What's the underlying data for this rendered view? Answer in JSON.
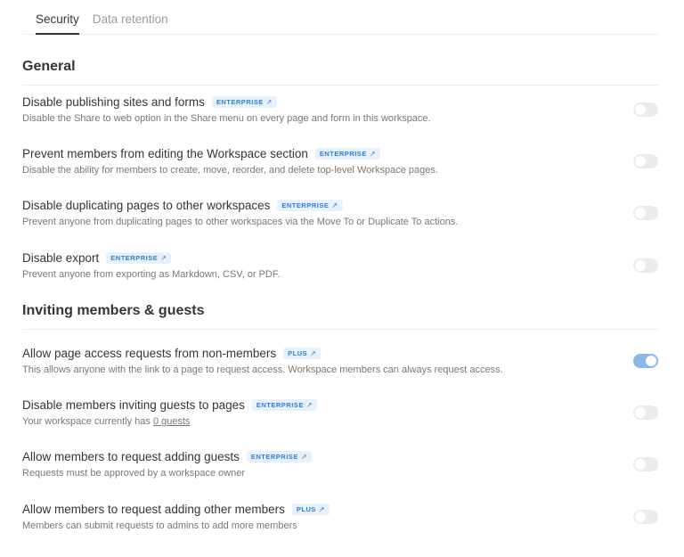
{
  "tabs": [
    {
      "label": "Security",
      "active": true
    },
    {
      "label": "Data retention",
      "active": false
    }
  ],
  "sections": [
    {
      "title": "General",
      "rows": [
        {
          "title": "Disable publishing sites and forms",
          "badge": "ENTERPRISE",
          "description": "Disable the Share to web option in the Share menu on every page and form in this workspace.",
          "toggle": false
        },
        {
          "title": "Prevent members from editing the Workspace section",
          "badge": "ENTERPRISE",
          "description": "Disable the ability for members to create, move, reorder, and delete top-level Workspace pages.",
          "toggle": false
        },
        {
          "title": "Disable duplicating pages to other workspaces",
          "badge": "ENTERPRISE",
          "description": "Prevent anyone from duplicating pages to other workspaces via the Move To or Duplicate To actions.",
          "toggle": false
        },
        {
          "title": "Disable export",
          "badge": "ENTERPRISE",
          "description": "Prevent anyone from exporting as Markdown, CSV, or PDF.",
          "toggle": false
        }
      ]
    },
    {
      "title": "Inviting members & guests",
      "rows": [
        {
          "title": "Allow page access requests from non-members",
          "badge": "PLUS",
          "description": "This allows anyone with the link to a page to request access. Workspace members can always request access.",
          "toggle": true
        },
        {
          "title": "Disable members inviting guests to pages",
          "badge": "ENTERPRISE",
          "description_prefix": "Your workspace currently has ",
          "description_link": "0 guests",
          "toggle": false
        },
        {
          "title": "Allow members to request adding guests",
          "badge": "ENTERPRISE",
          "description": "Requests must be approved by a workspace owner",
          "toggle": false
        },
        {
          "title": "Allow members to request adding other members",
          "badge": "PLUS",
          "description": "Members can submit requests to admins to add more members",
          "toggle": false
        }
      ]
    }
  ],
  "badge_arrow": "↗",
  "colors": {
    "badge_bg": "#e7f1fb",
    "badge_text": "#2f80d0",
    "toggle_on": "#8ab6ea",
    "toggle_off": "#ebebea",
    "divider": "#ebebea"
  }
}
